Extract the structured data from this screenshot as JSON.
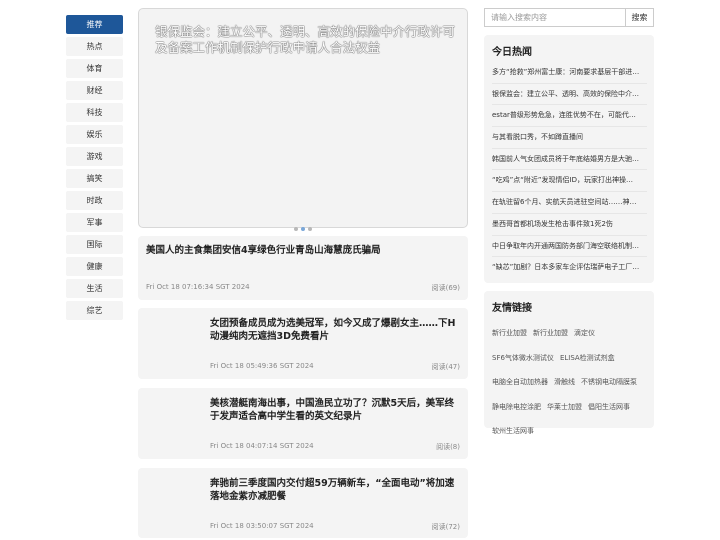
{
  "nav": {
    "items": [
      "推荐",
      "热点",
      "体育",
      "财经",
      "科技",
      "娱乐",
      "游戏",
      "搞笑",
      "时政",
      "军事",
      "国际",
      "健康",
      "生活",
      "综艺"
    ],
    "active_index": 0
  },
  "banner": {
    "title": "银保监会：建立公平、透明、高效的保险中介行政许可及备案工作机制保护行政申请人合法权益",
    "dots": 3,
    "active_dot": 1
  },
  "articles": [
    {
      "title": "美国人的主食集团安信4享绿色行业青岛山海慧庞氏骗局",
      "time": "Fri Oct 18 07:16:34 SGT 2024",
      "reads": "阅读(69)"
    },
    {
      "title": "女团预备成员成为选美冠军，如今又成了爆剧女主……下H动漫纯肉无遮挡3D免费看片",
      "time": "Fri Oct 18 05:49:36 SGT 2024",
      "reads": "阅读(47)"
    },
    {
      "title": "美核潜艇南海出事，中国渔民立功了？沉默5天后，美军终于发声适合高中学生看的英文纪录片",
      "time": "Fri Oct 18 04:07:14 SGT 2024",
      "reads": "阅读(8)"
    },
    {
      "title": "奔驰前三季度国内交付超59万辆新车，“全面电动”将加速落地金紫亦减肥餐",
      "time": "Fri Oct 18 03:50:07 SGT 2024",
      "reads": "阅读(72)"
    }
  ],
  "search": {
    "placeholder": "请输入搜索内容",
    "button": "搜索"
  },
  "hot": {
    "title": "今日热闻",
    "items": [
      "多方“抢救”郑州富士康：河南要求基层干部进…",
      "银保监会：建立公平、透明、高效的保险中介…",
      "estar普级形势危急，连胜优势不在，可能代…",
      "与其看脱口秀，不如蹲直播间",
      "韩国前人气女团成员将于年底结婚男方是大驰…",
      "“吃鸡”点“附近”发现情侣ID，玩家打出神操…",
      "在轨驻留6个月、实航天员进驻空间站……神…",
      "墨西哥首都机场发生枪击事件致1死2伤",
      "中日争取年内开通两国防务部门海空联络机制…",
      "“缺芯”加剧？日本多家车企评估瑞萨电子工厂…"
    ]
  },
  "links": {
    "title": "友情链接",
    "items": [
      "新行业加盟",
      "新行业加盟",
      "滴定仪",
      "SF6气体微水测试仪",
      "ELISA检测试剂盒",
      "电脑全自动加热器",
      "滑触线",
      "不锈钢电动隔膜泵",
      "静电除电控涂肥",
      "华莱士加盟",
      "倡阳生活网事",
      "软州生活网事"
    ]
  }
}
